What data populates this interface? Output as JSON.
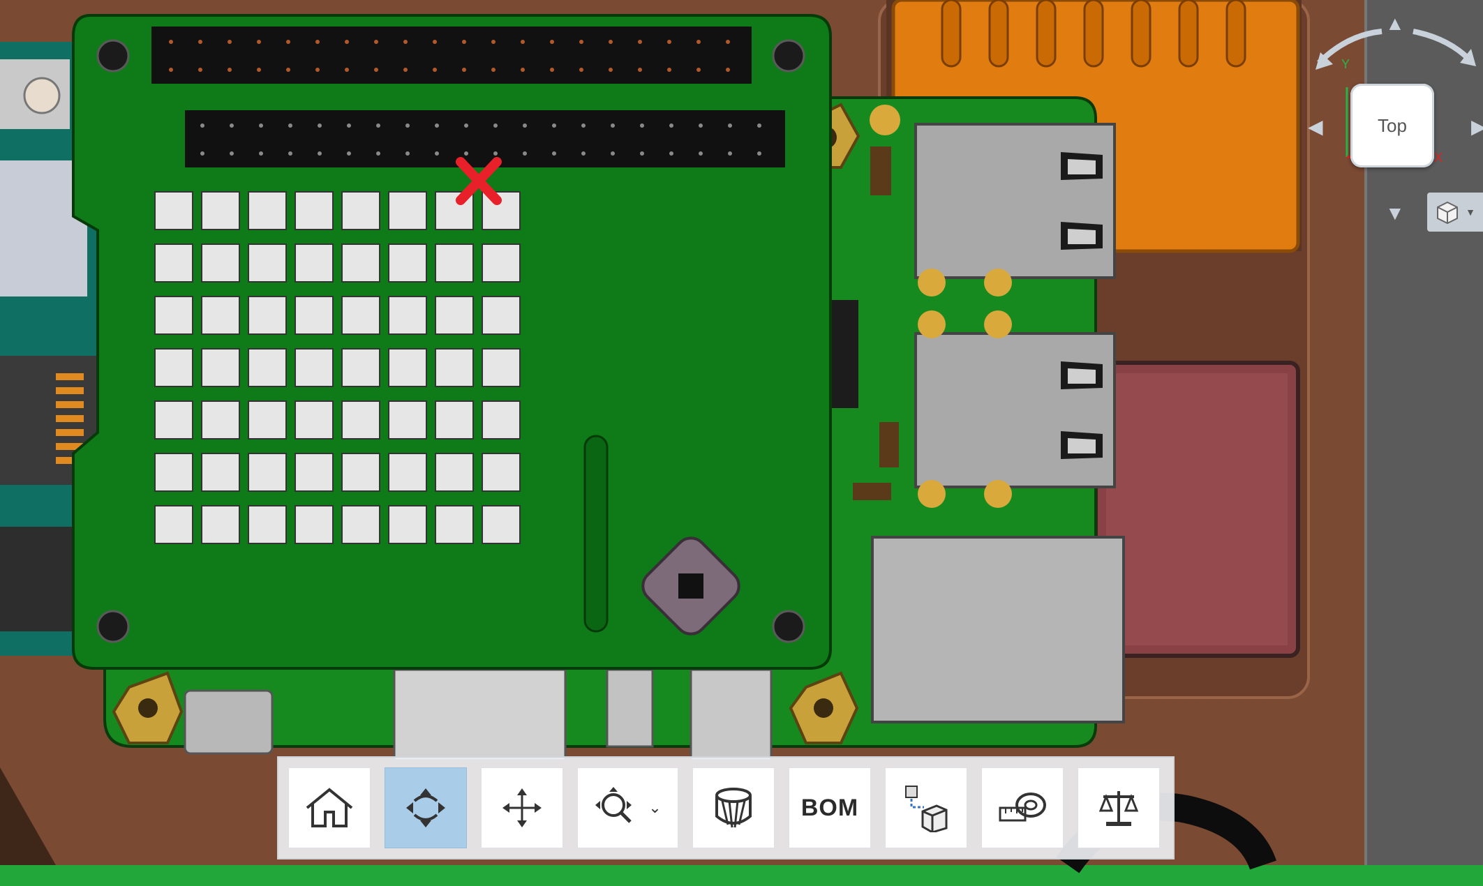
{
  "viewcube": {
    "face_label": "Top",
    "axis_x": "X",
    "axis_y": "Y",
    "icon": "cube-icon",
    "dropdown_icon": "caret-down-icon"
  },
  "toolbar": {
    "buttons": [
      {
        "name": "home-button",
        "icon": "home-icon",
        "active": false
      },
      {
        "name": "orbit-button",
        "icon": "orbit-icon",
        "active": true
      },
      {
        "name": "pan-button",
        "icon": "pan-icon",
        "active": false
      },
      {
        "name": "zoom-button",
        "icon": "zoom-icon",
        "active": false
      },
      {
        "name": "section-button",
        "icon": "section-analysis-icon",
        "active": false
      },
      {
        "name": "bom-button",
        "label": "BOM",
        "active": false
      },
      {
        "name": "explode-button",
        "icon": "explode-icon",
        "active": false
      },
      {
        "name": "measure-button",
        "icon": "measure-tape-icon",
        "active": false
      },
      {
        "name": "mass-properties-button",
        "icon": "balance-scale-icon",
        "active": false
      }
    ]
  },
  "colors": {
    "pcb_green": "#0f7a1a",
    "copper": "#7a4a33",
    "orange_part": "#e07c10",
    "red_part": "#8a4145",
    "toolbar_active": "#a9cde8",
    "marker_red": "#e8202a"
  }
}
